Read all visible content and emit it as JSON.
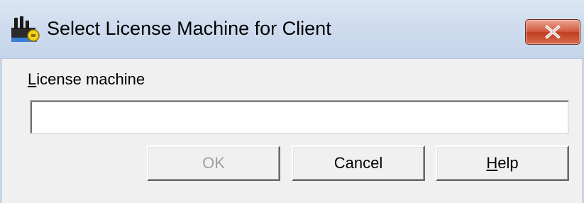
{
  "window": {
    "title": "Select License Machine for Client",
    "icon": "license-server-icon",
    "close_icon": "close-icon"
  },
  "form": {
    "label_mnemonic": "L",
    "label_rest": "icense machine",
    "input_value": ""
  },
  "buttons": {
    "ok_label": "OK",
    "ok_enabled": false,
    "cancel_label": "Cancel",
    "help_mnemonic": "H",
    "help_rest": "elp"
  },
  "colors": {
    "close_button": "#c9452a",
    "disabled_text": "#a0a0a0",
    "dialog_bg": "#f0f0f0"
  }
}
